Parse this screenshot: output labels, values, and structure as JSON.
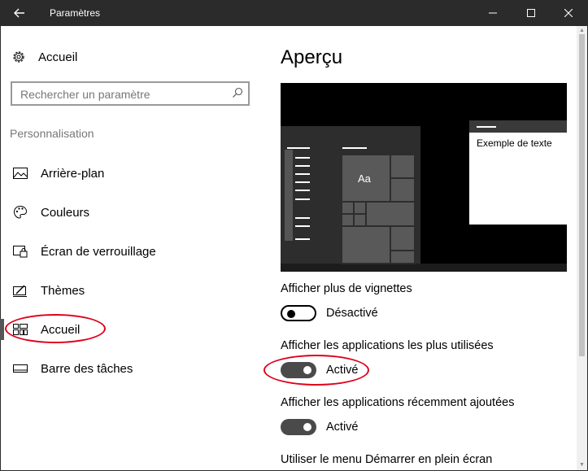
{
  "window": {
    "title": "Paramètres",
    "back_icon": "back-arrow-icon"
  },
  "sidebar": {
    "home_label": "Accueil",
    "search_placeholder": "Rechercher un paramètre",
    "section_title": "Personnalisation",
    "items": [
      {
        "label": "Arrière-plan",
        "icon": "picture-icon"
      },
      {
        "label": "Couleurs",
        "icon": "palette-icon"
      },
      {
        "label": "Écran de verrouillage",
        "icon": "lock-screen-icon"
      },
      {
        "label": "Thèmes",
        "icon": "themes-icon"
      },
      {
        "label": "Accueil",
        "icon": "start-icon",
        "selected": true
      },
      {
        "label": "Barre des tâches",
        "icon": "taskbar-icon"
      }
    ]
  },
  "main": {
    "title": "Aperçu",
    "preview": {
      "sample_text": "Exemple de texte",
      "tile_label": "Aa"
    },
    "settings": [
      {
        "label": "Afficher plus de vignettes",
        "state": "Désactivé",
        "on": false
      },
      {
        "label": "Afficher les applications les plus utilisées",
        "state": "Activé",
        "on": true
      },
      {
        "label": "Afficher les applications récemment ajoutées",
        "state": "Activé",
        "on": true
      },
      {
        "label": "Utiliser le menu Démarrer en plein écran"
      }
    ]
  },
  "colors": {
    "titlebar": "#2b2b2b",
    "annotation": "#e0001a",
    "toggle_on": "#4a4a4a"
  }
}
